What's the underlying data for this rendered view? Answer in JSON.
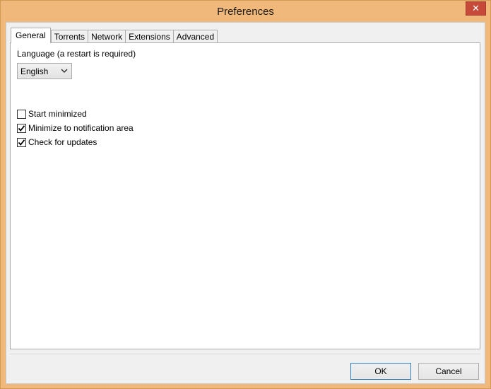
{
  "window": {
    "title": "Preferences",
    "close_symbol": "✕"
  },
  "tabs": [
    {
      "label": "General",
      "active": true
    },
    {
      "label": "Torrents",
      "active": false
    },
    {
      "label": "Network",
      "active": false
    },
    {
      "label": "Extensions",
      "active": false
    },
    {
      "label": "Advanced",
      "active": false
    }
  ],
  "general": {
    "language_label": "Language (a restart is required)",
    "language_value": "English",
    "options": [
      {
        "label": "Start minimized",
        "checked": false
      },
      {
        "label": "Minimize to notification area",
        "checked": true
      },
      {
        "label": "Check for updates",
        "checked": true
      }
    ]
  },
  "buttons": {
    "ok": "OK",
    "cancel": "Cancel"
  },
  "colors": {
    "frame": "#f0b87a",
    "close": "#c7493a",
    "default_button_border": "#3c7fb1"
  }
}
